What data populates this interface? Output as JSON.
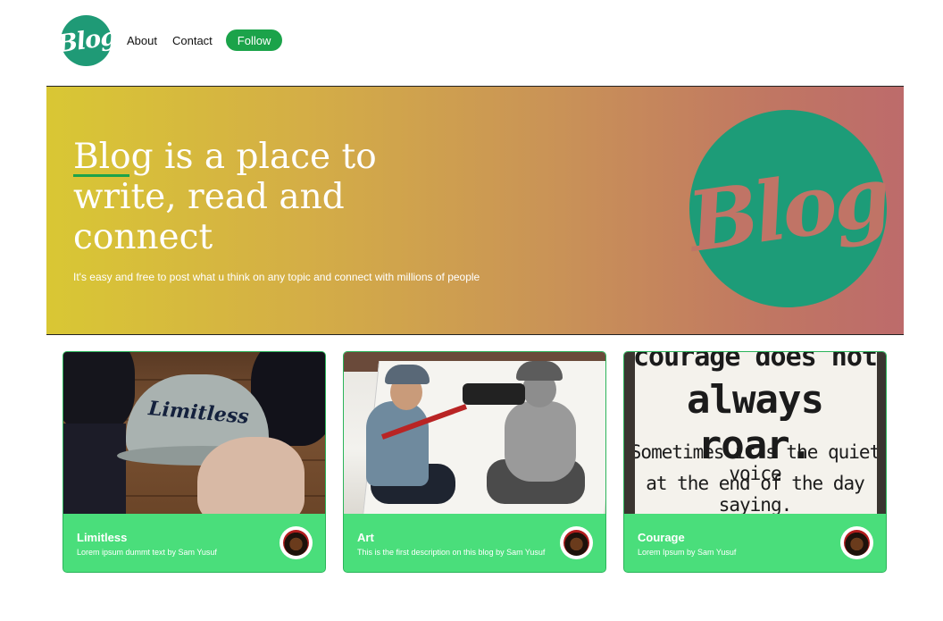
{
  "nav": {
    "logo_text": "Blog",
    "links": [
      "About",
      "Contact"
    ],
    "follow_label": "Follow"
  },
  "hero": {
    "title": "Blog is a place to write, read and connect",
    "subtitle": "It's easy and free to post what u think on any topic and connect with millions of people",
    "logo_text": "Blog"
  },
  "cards": [
    {
      "title": "Limitless",
      "description": "Lorem ipsum dummt text by Sam Yusuf",
      "image_text": "Limitless"
    },
    {
      "title": "Art",
      "description": "This is the first description on this blog by Sam Yusuf"
    },
    {
      "title": "Courage",
      "description": "Lorem Ipsum by Sam Yusuf",
      "image_lines": [
        "courage does not",
        "always roar.",
        "Sometimes it's the quiet voice",
        "at the end of the day saying."
      ]
    }
  ],
  "colors": {
    "brand_green": "#1ba34a",
    "card_green": "#4ade7b",
    "logo_teal": "#1f9a76"
  }
}
